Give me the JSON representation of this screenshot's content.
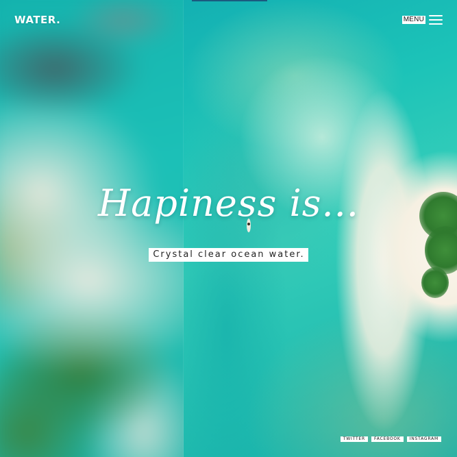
{
  "header": {
    "logo": "WATER.",
    "menu_label": "MENU"
  },
  "hero": {
    "title": "Hapiness is...",
    "subtitle": "Crystal clear ocean water."
  },
  "social": {
    "links": [
      "TWITTER",
      "FACEBOOK",
      "INSTAGRAM"
    ]
  },
  "icons": [
    "hamburger-menu-icon"
  ],
  "colors": {
    "water": "#1cc3b8",
    "sand": "#f6f0e2",
    "text": "#ffffff"
  }
}
